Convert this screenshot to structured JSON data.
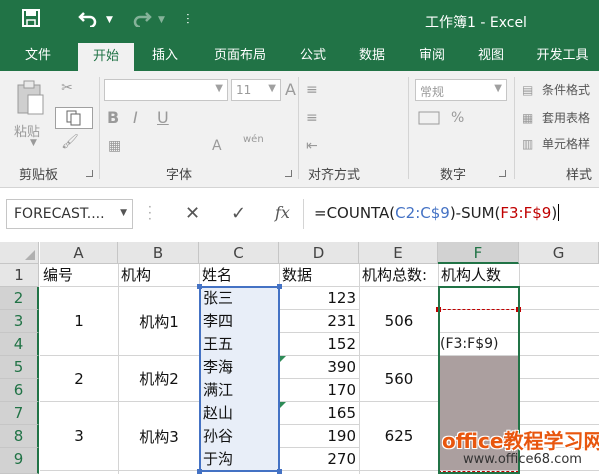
{
  "app": {
    "title": "工作簿1 - Excel",
    "accent_color": "#217346"
  },
  "qat": {
    "save_icon": "save-icon",
    "undo_icon": "undo-icon",
    "redo_icon": "redo-icon"
  },
  "tabs": [
    {
      "label": "文件",
      "active": false
    },
    {
      "label": "开始",
      "active": true
    },
    {
      "label": "插入",
      "active": false
    },
    {
      "label": "页面布局",
      "active": false
    },
    {
      "label": "公式",
      "active": false
    },
    {
      "label": "数据",
      "active": false
    },
    {
      "label": "审阅",
      "active": false
    },
    {
      "label": "视图",
      "active": false
    },
    {
      "label": "开发工具",
      "active": false
    }
  ],
  "ribbon": {
    "clipboard": {
      "paste_label": "粘贴",
      "group_label": "剪贴板"
    },
    "font": {
      "group_label": "字体",
      "font_name": "",
      "font_size": "11",
      "bold": "B",
      "italic": "I",
      "underline": "U",
      "font_grow": "A",
      "font_shrink": "A",
      "phonetic": "wén",
      "font_color": "A"
    },
    "alignment": {
      "group_label": "对齐方式"
    },
    "number": {
      "group_label": "数字",
      "format": "常规",
      "currency": "%",
      "percent": "%"
    },
    "styles": {
      "group_label": "样式",
      "conditional": "条件格式",
      "table": "套用表格",
      "cell": "单元格样"
    }
  },
  "formula_bar": {
    "name_box": "FORECAST....",
    "cancel": "✕",
    "enter": "✓",
    "fx": "fx",
    "formula_prefix": "=COUNTA(",
    "formula_ref1": "C2:C$9",
    "formula_middle": ")-SUM(",
    "formula_ref2": "F3:F$9",
    "formula_suffix": ")"
  },
  "sheet": {
    "columns": [
      "A",
      "B",
      "C",
      "D",
      "E",
      "F",
      "G"
    ],
    "rows": [
      "1",
      "2",
      "3",
      "4",
      "5",
      "6",
      "7",
      "8",
      "9"
    ],
    "headers": {
      "A": "编号",
      "B": "机构",
      "C": "姓名",
      "D": "数据",
      "E": "机构总数:",
      "F": "机构人数"
    },
    "names": [
      "张三",
      "李四",
      "王五",
      "李海",
      "满江",
      "赵山",
      "孙谷",
      "于沟"
    ],
    "data": [
      "123",
      "231",
      "152",
      "390",
      "170",
      "165",
      "190",
      "270"
    ],
    "groups": [
      {
        "id": "1",
        "org": "机构1",
        "total": "506"
      },
      {
        "id": "2",
        "org": "机构2",
        "total": "560"
      },
      {
        "id": "3",
        "org": "机构3",
        "total": "625"
      }
    ],
    "edit_tooltip": "(F3:F$9)"
  },
  "watermark": {
    "line1": "office教程学习网",
    "line2": "www.office68.com"
  }
}
